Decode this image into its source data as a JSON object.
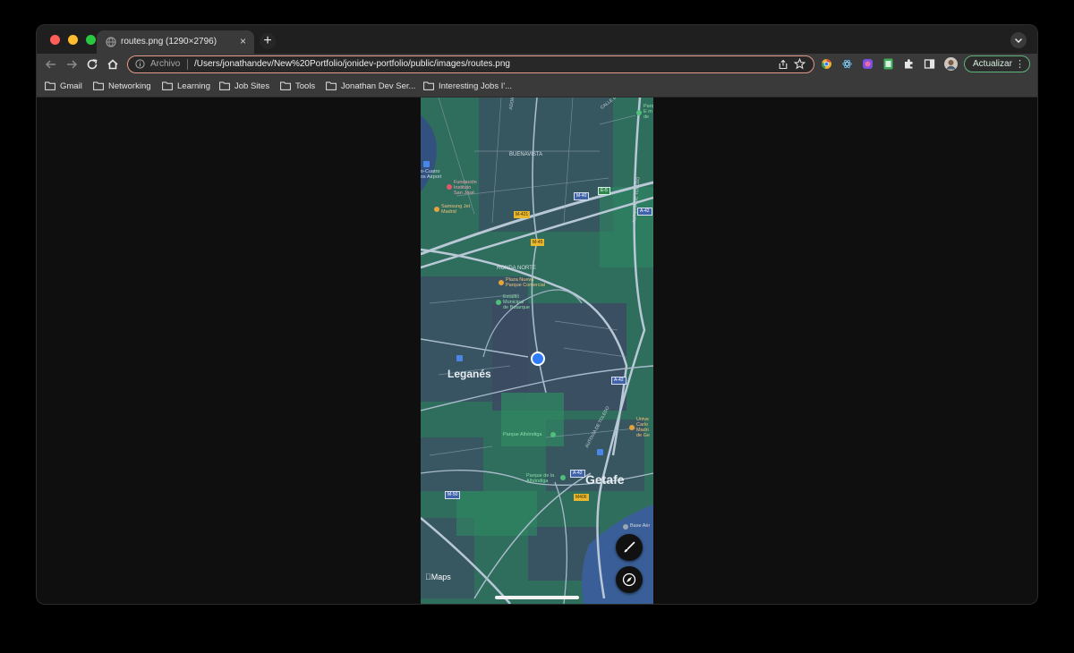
{
  "window": {
    "traffic_lights": [
      "#ff5f57",
      "#febc2e",
      "#28c840"
    ]
  },
  "tab": {
    "title": "routes.png (1290×2796)",
    "close_glyph": "×",
    "new_tab_glyph": "+"
  },
  "toolbar": {
    "back_icon": "arrow-left-icon",
    "forward_icon": "arrow-right-icon",
    "reload_icon": "reload-icon",
    "home_icon": "home-icon",
    "address_label": "Archivo",
    "url": "/Users/jonathandev/New%20Portfolio/jonidev-portfolio/public/images/routes.png",
    "update_label": "Actualizar",
    "menu_glyph": "⋮"
  },
  "bookmarks": [
    {
      "label": "Gmail"
    },
    {
      "label": "Networking"
    },
    {
      "label": "Learning"
    },
    {
      "label": "Job Sites"
    },
    {
      "label": "Tools"
    },
    {
      "label": "Jonathan Dev Ser..."
    },
    {
      "label": "Interesting Jobs I'..."
    }
  ],
  "map": {
    "cities": {
      "leganes": "Leganés",
      "getafe": "Getafe"
    },
    "neighborhoods": {
      "buenavista": "BUENAVISTA",
      "ronda_norte": "RONDA NORTE"
    },
    "pois": {
      "fundacion": "Fundación\nInstituto\nSan José",
      "samsung": "Samsung Jet\nMadrid",
      "plaza_nueva": "Plaza Nueva\nParque Comercial",
      "estadio": "Estadio\nMunicipal\nde Butarque",
      "parque_alhondiga": "Parque Alhóndiga",
      "parque_amordiga": "Parque de la\nAlhóndiga",
      "cuatro_vientos": "o-Cuatro\nos Airport",
      "universidad": "Unive\nCarlo\nMadri\nde Ge",
      "base_aerea": "Base Aér",
      "top_right": "Parq\nE m\nde"
    },
    "road_shields": {
      "m40_a": "M-40",
      "e5": "E-5",
      "m421": "M-421",
      "m45": "M-45",
      "a42_a": "A-42",
      "a42_b": "A-42",
      "a42_c": "A-42",
      "m50": "M-50",
      "m406": "M406"
    },
    "street_labels": {
      "calle_de_la": "CALLE DE LA VÍA",
      "autovia": "AUTOVÍA DE TOLEDO",
      "autovia_2": "AUTOVÍA DE TOLEDO",
      "road_top": "ADOR"
    },
    "logo": "Maps",
    "controls": {
      "brush_icon": "paintbrush-icon",
      "compass_icon": "compass-icon"
    }
  }
}
